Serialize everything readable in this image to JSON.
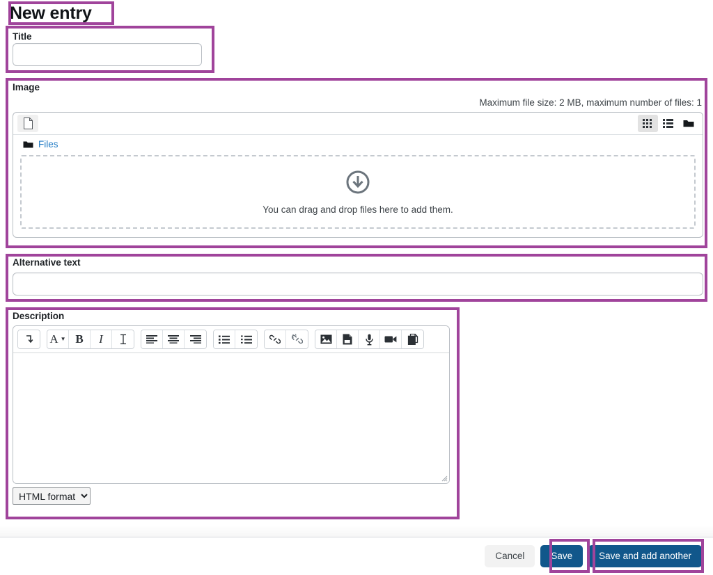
{
  "page": {
    "title": "New entry"
  },
  "fields": {
    "title": {
      "label": "Title",
      "value": "",
      "placeholder": ""
    },
    "image": {
      "label": "Image",
      "max_note": "Maximum file size: 2 MB, maximum number of files: 1",
      "filemanager": {
        "add_file_title": "Add...",
        "view_grid_title": "Display folder with file icons",
        "view_list_title": "Display folder with file details",
        "view_tree_title": "Display folder as file tree",
        "breadcrumb": "Files",
        "dropzone_text": "You can drag and drop files here to add them."
      }
    },
    "alt_text": {
      "label": "Alternative text",
      "value": "",
      "placeholder": ""
    },
    "description": {
      "label": "Description",
      "value": "",
      "format_selected": "HTML format",
      "format_options": [
        "HTML format"
      ],
      "toolbar": [
        {
          "group": 1,
          "items": [
            {
              "name": "expand-toolbar-icon",
              "label": "Show more buttons"
            }
          ]
        },
        {
          "group": 2,
          "items": [
            {
              "name": "font-style-icon",
              "label": "A"
            },
            {
              "name": "bold-icon",
              "label": "B"
            },
            {
              "name": "italic-icon",
              "label": "I"
            },
            {
              "name": "clear-formatting-icon",
              "label": "I"
            }
          ]
        },
        {
          "group": 3,
          "items": [
            {
              "name": "align-left-icon",
              "label": "Align left"
            },
            {
              "name": "align-center-icon",
              "label": "Align center"
            },
            {
              "name": "align-right-icon",
              "label": "Align right"
            }
          ]
        },
        {
          "group": 4,
          "items": [
            {
              "name": "bulleted-list-icon",
              "label": "Bulleted list"
            },
            {
              "name": "numbered-list-icon",
              "label": "Numbered list"
            }
          ]
        },
        {
          "group": 5,
          "items": [
            {
              "name": "link-icon",
              "label": "Link"
            },
            {
              "name": "unlink-icon",
              "label": "Unlink"
            }
          ]
        },
        {
          "group": 6,
          "items": [
            {
              "name": "image-icon",
              "label": "Image"
            },
            {
              "name": "media-file-icon",
              "label": "Manage files"
            },
            {
              "name": "microphone-icon",
              "label": "Record audio"
            },
            {
              "name": "video-camera-icon",
              "label": "Record video"
            },
            {
              "name": "manage-files-icon",
              "label": "Manage files"
            }
          ]
        }
      ]
    }
  },
  "footer": {
    "cancel_label": "Cancel",
    "save_label": "Save",
    "save_add_another_label": "Save and add another"
  },
  "colors": {
    "highlight": "#a0449b",
    "primary_button": "#11578b",
    "link": "#1f7ac4"
  }
}
